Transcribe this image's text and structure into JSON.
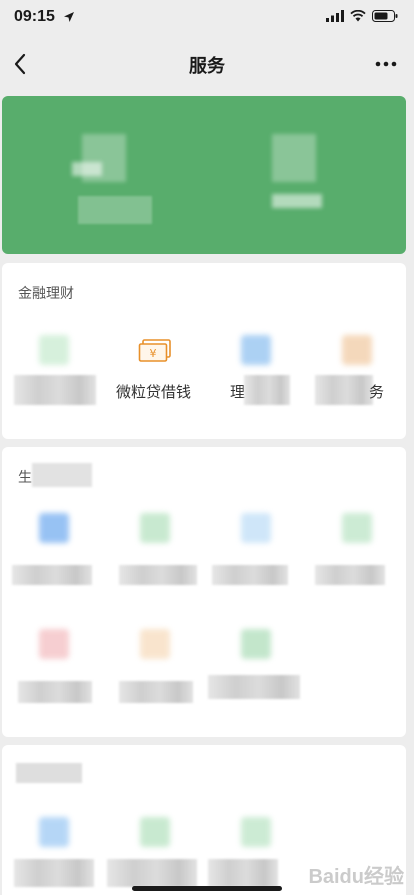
{
  "status": {
    "time": "09:15"
  },
  "nav": {
    "title": "服务"
  },
  "hero": {
    "items": [
      {
        "label": ""
      },
      {
        "label": ""
      }
    ]
  },
  "sections": [
    {
      "title": "金融理财",
      "items": [
        {
          "label": "",
          "icon": "wallet-icon"
        },
        {
          "label": "微粒贷借钱",
          "icon": "yuan-bill-icon"
        },
        {
          "label": "理",
          "icon": "finance-icon"
        },
        {
          "label": "务",
          "icon": "insurance-icon"
        }
      ]
    },
    {
      "title": "生",
      "items": [
        {
          "label": "",
          "icon": "phone-icon"
        },
        {
          "label": "",
          "icon": "utility-icon"
        },
        {
          "label": "",
          "icon": "water-icon"
        },
        {
          "label": "",
          "icon": "city-service-icon"
        },
        {
          "label": "",
          "icon": "gift-icon"
        },
        {
          "label": "",
          "icon": "health-icon"
        },
        {
          "label": "",
          "icon": "charity-icon"
        }
      ]
    },
    {
      "title": "",
      "items": [
        {
          "label": "",
          "icon": "ticket-icon"
        },
        {
          "label": "",
          "icon": "shopping-icon"
        },
        {
          "label": "",
          "icon": "car-icon"
        }
      ]
    }
  ],
  "watermark": "Baidu经验",
  "colors": {
    "hero": "#58ad6c",
    "accent": "#e8902a"
  }
}
